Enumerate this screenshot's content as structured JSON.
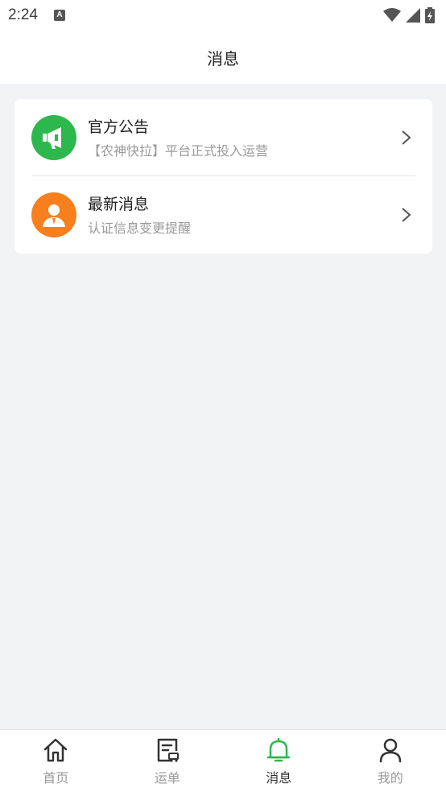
{
  "status_bar": {
    "time": "2:24",
    "app_icon": "A"
  },
  "header": {
    "title": "消息"
  },
  "messages": [
    {
      "title": "官方公告",
      "subtitle": "【农神快拉】平台正式投入运营",
      "icon": "megaphone-icon",
      "color": "#2db84d"
    },
    {
      "title": "最新消息",
      "subtitle": "认证信息变更提醒",
      "icon": "person-icon",
      "color": "#f87f1d"
    }
  ],
  "tabs": [
    {
      "label": "首页",
      "icon": "home-icon",
      "active": false
    },
    {
      "label": "运单",
      "icon": "waybill-icon",
      "active": false
    },
    {
      "label": "消息",
      "icon": "bell-icon",
      "active": true
    },
    {
      "label": "我的",
      "icon": "profile-icon",
      "active": false
    }
  ],
  "colors": {
    "accent": "#2db84d",
    "orange": "#f87f1d",
    "background": "#f2f3f5"
  }
}
